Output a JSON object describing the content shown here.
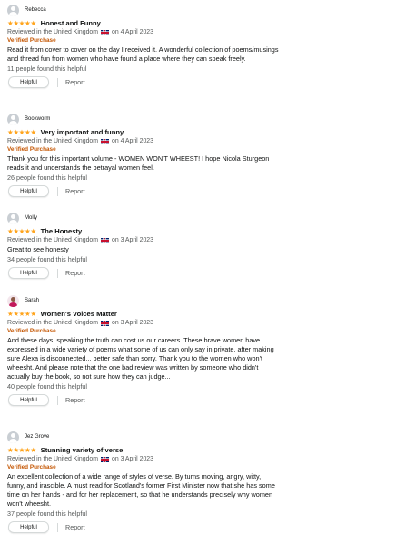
{
  "reviews": [
    {
      "username": "Rebecca",
      "avatar": "default-avatar-icon",
      "stars": 5,
      "title": "Honest and Funny",
      "meta_prefix": "Reviewed in the United Kingdom",
      "meta_suffix": "on 4 April 2023",
      "verified": "Verified Purchase",
      "text": "Read it from cover to cover on the day I received it. A wonderful collection of poems/musings and thread fun from women who have found a place where they can speak freely.",
      "helpful_count": "11 people found this helpful",
      "helpful_label": "Helpful",
      "report_label": "Report"
    },
    {
      "username": "Bookworm",
      "avatar": "default-avatar-icon",
      "stars": 5,
      "title": "Very important and funny",
      "meta_prefix": "Reviewed in the United Kingdom",
      "meta_suffix": "on 4 April 2023",
      "verified": "Verified Purchase",
      "text": "Thank you for this important volume - WOMEN WON'T WHEEST! I hope Nicola Sturgeon reads it and understands the betrayal women feel.",
      "helpful_count": "26 people found this helpful",
      "helpful_label": "Helpful",
      "report_label": "Report"
    },
    {
      "username": "Molly",
      "avatar": "default-avatar-icon",
      "stars": 5,
      "title": "The Honesty",
      "meta_prefix": "Reviewed in the United Kingdom",
      "meta_suffix": "on 3 April 2023",
      "verified": "",
      "text": "Great to see honesty",
      "helpful_count": "34 people found this helpful",
      "helpful_label": "Helpful",
      "report_label": "Report"
    },
    {
      "username": "Sarah",
      "avatar": "photo-avatar",
      "stars": 5,
      "title": "Women's Voices Matter",
      "meta_prefix": "Reviewed in the United Kingdom",
      "meta_suffix": "on 3 April 2023",
      "verified": "Verified Purchase",
      "text": "And these days, speaking the truth can cost us our careers. These brave women have expressed in a wide variety of poems what some of us can only say in private, after making sure Alexa is disconnected... better safe than sorry. Thank you to the women who won't wheesht. And please note that the one bad review was written by someone who didn't actually buy the book, so not sure how they can judge...",
      "helpful_count": "40 people found this helpful",
      "helpful_label": "Helpful",
      "report_label": "Report"
    },
    {
      "username": "Jez Grove",
      "avatar": "default-avatar-icon",
      "stars": 5,
      "title": "Stunning variety of verse",
      "meta_prefix": "Reviewed in the United Kingdom",
      "meta_suffix": "on 3 April 2023",
      "verified": "Verified Purchase",
      "text": "An excellent collection of a wide range of styles of verse. By turns moving, angry, witty, funny, and irascible. A must read for Scotland's former First Minister now that she has some time on her hands - and for her replacement, so that he understands precisely why women won't wheesht.",
      "helpful_count": "37 people found this helpful",
      "helpful_label": "Helpful",
      "report_label": "Report"
    }
  ],
  "colors": {
    "star": "#ffa41c",
    "verified": "#c45500",
    "meta": "#565959",
    "text": "#0f1111"
  }
}
